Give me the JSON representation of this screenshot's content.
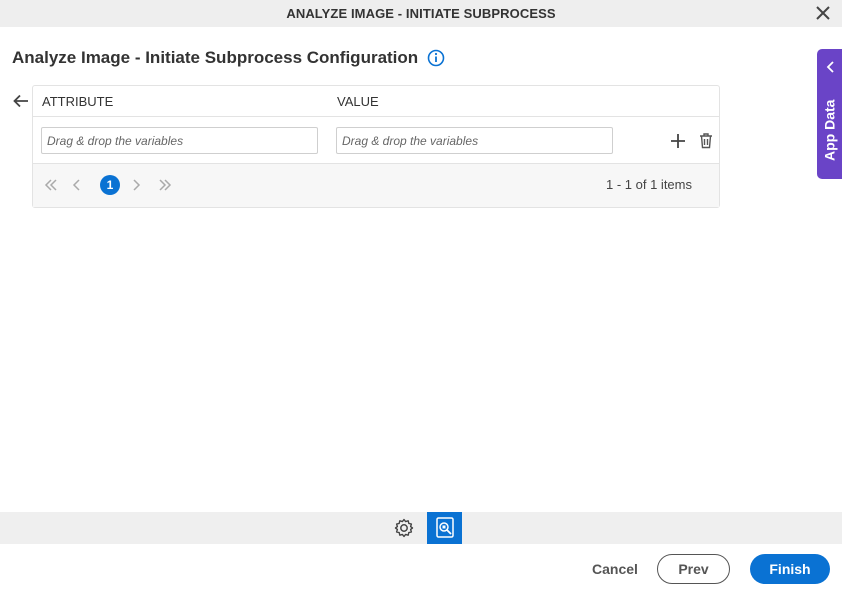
{
  "window": {
    "title": "ANALYZE IMAGE - INITIATE SUBPROCESS"
  },
  "page": {
    "heading": "Analyze Image - Initiate Subprocess Configuration"
  },
  "grid": {
    "columns": [
      "ATTRIBUTE",
      "VALUE"
    ],
    "row": {
      "attribute_placeholder": "Drag & drop the variables",
      "value_placeholder": "Drag & drop the variables"
    },
    "pager": {
      "current_page": "1",
      "info": "1 - 1 of 1 items"
    }
  },
  "side_panel": {
    "label": "App Data"
  },
  "footer": {
    "cancel_label": "Cancel",
    "prev_label": "Prev",
    "finish_label": "Finish"
  },
  "colors": {
    "accent": "#0a72d3",
    "side_panel": "#6a44c7"
  }
}
